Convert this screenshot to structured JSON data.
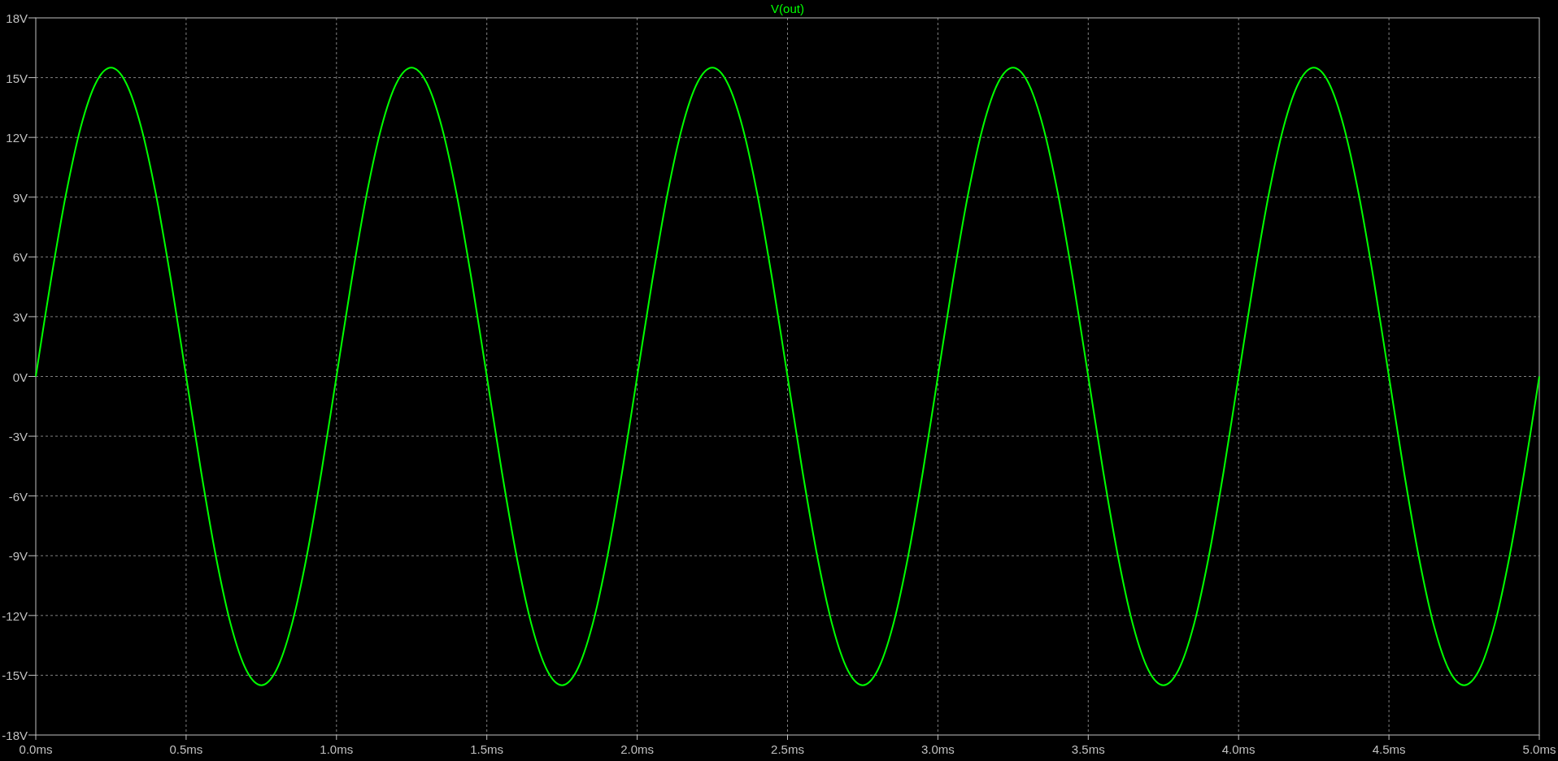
{
  "chart_data": {
    "type": "line",
    "grid": true,
    "x": [
      0,
      0.05,
      0.1,
      0.15,
      0.2,
      0.25,
      0.3,
      0.35,
      0.4,
      0.45,
      0.5,
      0.55,
      0.6,
      0.65,
      0.7,
      0.75,
      0.8,
      0.85,
      0.9,
      0.95,
      1,
      1.05,
      1.1,
      1.15,
      1.2,
      1.25,
      1.3,
      1.35,
      1.4,
      1.45,
      1.5,
      1.55,
      1.6,
      1.65,
      1.7,
      1.75,
      1.8,
      1.85,
      1.9,
      1.95,
      2,
      2.05,
      2.1,
      2.15,
      2.2,
      2.25,
      2.3,
      2.35,
      2.4,
      2.45,
      2.5,
      2.55,
      2.6,
      2.65,
      2.7,
      2.75,
      2.8,
      2.85,
      2.9,
      2.95,
      3,
      3.05,
      3.1,
      3.15,
      3.2,
      3.25,
      3.3,
      3.35,
      3.4,
      3.45,
      3.5,
      3.55,
      3.6,
      3.65,
      3.7,
      3.75,
      3.8,
      3.85,
      3.9,
      3.95,
      4,
      4.05,
      4.1,
      4.15,
      4.2,
      4.25,
      4.3,
      4.35,
      4.4,
      4.45,
      4.5,
      4.55,
      4.6,
      4.65,
      4.7,
      4.75,
      4.8,
      4.85,
      4.9,
      4.95,
      5
    ],
    "series": [
      {
        "name": "V(out)",
        "color": "#00ff00",
        "values": [
          0,
          4.79,
          9.11,
          12.54,
          14.74,
          15.5,
          14.74,
          12.54,
          9.11,
          4.79,
          0,
          -4.79,
          -9.11,
          -12.54,
          -14.74,
          -15.5,
          -14.74,
          -12.54,
          -9.11,
          -4.79,
          0,
          4.79,
          9.11,
          12.54,
          14.74,
          15.5,
          14.74,
          12.54,
          9.11,
          4.79,
          0,
          -4.79,
          -9.11,
          -12.54,
          -14.74,
          -15.5,
          -14.74,
          -12.54,
          -9.11,
          -4.79,
          0,
          4.79,
          9.11,
          12.54,
          14.74,
          15.5,
          14.74,
          12.54,
          9.11,
          4.79,
          0,
          -4.79,
          -9.11,
          -12.54,
          -14.74,
          -15.5,
          -14.74,
          -12.54,
          -9.11,
          -4.79,
          0,
          4.79,
          9.11,
          12.54,
          14.74,
          15.5,
          14.74,
          12.54,
          9.11,
          4.79,
          0,
          -4.79,
          -9.11,
          -12.54,
          -14.74,
          -15.5,
          -14.74,
          -12.54,
          -9.11,
          -4.79,
          0,
          4.79,
          9.11,
          12.54,
          14.74,
          15.5,
          14.74,
          12.54,
          9.11,
          4.79,
          0,
          -4.79,
          -9.11,
          -12.54,
          -14.74,
          -15.5,
          -14.74,
          -12.54,
          -9.11,
          -4.79,
          0
        ]
      }
    ],
    "xlim": [
      0,
      5
    ],
    "ylim": [
      -18,
      18
    ],
    "xticks": [
      {
        "value": 0,
        "label": "0.0ms"
      },
      {
        "value": 0.5,
        "label": "0.5ms"
      },
      {
        "value": 1,
        "label": "1.0ms"
      },
      {
        "value": 1.5,
        "label": "1.5ms"
      },
      {
        "value": 2,
        "label": "2.0ms"
      },
      {
        "value": 2.5,
        "label": "2.5ms"
      },
      {
        "value": 3,
        "label": "3.0ms"
      },
      {
        "value": 3.5,
        "label": "3.5ms"
      },
      {
        "value": 4,
        "label": "4.0ms"
      },
      {
        "value": 4.5,
        "label": "4.5ms"
      },
      {
        "value": 5,
        "label": "5.0ms"
      }
    ],
    "yticks": [
      {
        "value": 18,
        "label": "18V"
      },
      {
        "value": 15,
        "label": "15V"
      },
      {
        "value": 12,
        "label": "12V"
      },
      {
        "value": 9,
        "label": "9V"
      },
      {
        "value": 6,
        "label": "6V"
      },
      {
        "value": 3,
        "label": "3V"
      },
      {
        "value": 0,
        "label": "0V"
      },
      {
        "value": -3,
        "label": "-3V"
      },
      {
        "value": -6,
        "label": "-6V"
      },
      {
        "value": -9,
        "label": "-9V"
      },
      {
        "value": -12,
        "label": "-12V"
      },
      {
        "value": -15,
        "label": "-15V"
      },
      {
        "value": -18,
        "label": "-18V"
      }
    ]
  }
}
